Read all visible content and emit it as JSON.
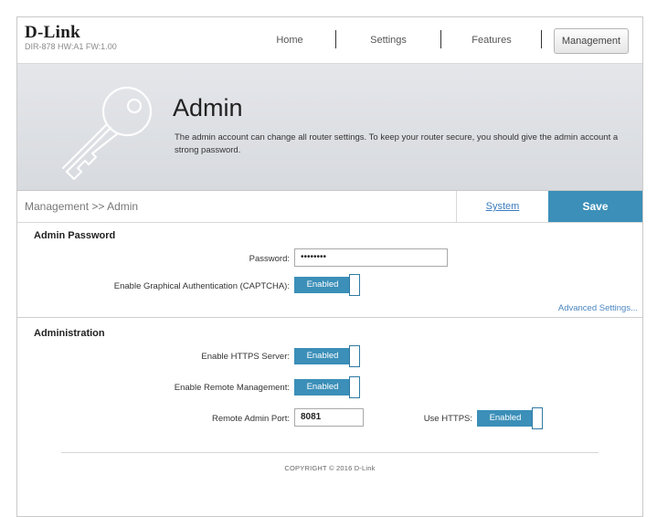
{
  "brand": {
    "logo": "D-Link",
    "model_info": "DIR-878 HW:A1 FW:1.00"
  },
  "nav": {
    "home": "Home",
    "settings": "Settings",
    "features": "Features",
    "management": "Management"
  },
  "hero": {
    "title": "Admin",
    "description": "The admin account can change all router settings. To keep your router secure, you should give the admin account a strong password."
  },
  "breadcrumb": "Management >> Admin",
  "actions": {
    "system": "System",
    "save": "Save"
  },
  "admin_password": {
    "section_title": "Admin Password",
    "password_label": "Password:",
    "password_value": "••••••••",
    "captcha_label": "Enable Graphical Authentication (CAPTCHA):",
    "captcha_state": "Enabled",
    "advanced_link": "Advanced Settings..."
  },
  "administration": {
    "section_title": "Administration",
    "https_label": "Enable HTTPS Server:",
    "https_state": "Enabled",
    "remote_label": "Enable Remote Management:",
    "remote_state": "Enabled",
    "port_label": "Remote Admin Port:",
    "port_value": "8081",
    "use_https_label": "Use HTTPS:",
    "use_https_state": "Enabled"
  },
  "footer": {
    "copyright": "COPYRIGHT © 2016 D-Link"
  },
  "colors": {
    "accent": "#3b8fb8",
    "link": "#4a86c0",
    "hero_bg": "#dfe2e6"
  }
}
